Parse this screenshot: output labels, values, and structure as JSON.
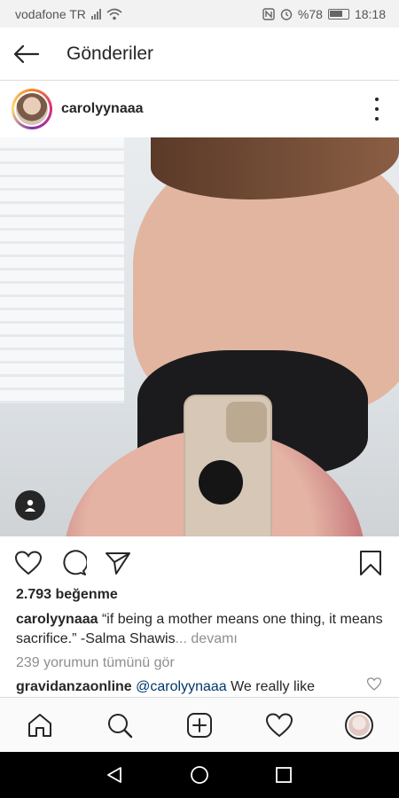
{
  "status_bar": {
    "carrier": "vodafone TR",
    "battery": "%78",
    "time": "18:18"
  },
  "header": {
    "title": "Gönderiler"
  },
  "post": {
    "username": "carolyynaaa",
    "likes": "2.793 beğenme",
    "caption_user": "carolyynaaa",
    "caption_text": " “if being a mother means one thing, it means sacrifice.” -Salma Shawis",
    "caption_more": "... devamı",
    "view_comments": "239 yorumun tümünü gör",
    "comment": {
      "user": "gravidanzaonline",
      "mention": "@carolyynaaa",
      "text": " We really like"
    }
  },
  "icons": {
    "back": "arrow-left-icon",
    "more": "more-vertical-icon",
    "like": "heart-icon",
    "comment": "comment-icon",
    "share": "send-icon",
    "save": "bookmark-icon",
    "home": "home-icon",
    "search": "search-icon",
    "new_post": "plus-square-icon",
    "activity": "heart-icon",
    "profile": "avatar-icon"
  }
}
